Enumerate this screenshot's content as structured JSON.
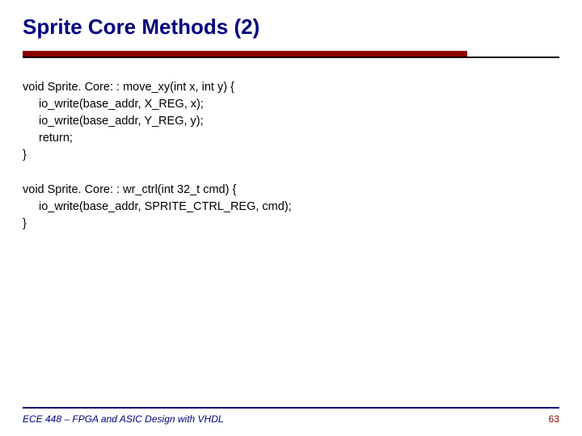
{
  "title": "Sprite Core Methods (2)",
  "code1": {
    "l1": "void Sprite. Core: : move_xy(int x, int y) {",
    "l2": "io_write(base_addr, X_REG, x);",
    "l3": "io_write(base_addr, Y_REG, y);",
    "l4": "return;",
    "l5": "}"
  },
  "code2": {
    "l1": "void Sprite. Core: : wr_ctrl(int 32_t cmd) {",
    "l2": "io_write(base_addr, SPRITE_CTRL_REG, cmd);",
    "l3": "}"
  },
  "footer": {
    "course": "ECE 448 – FPGA and ASIC Design with VHDL",
    "page": "63"
  }
}
